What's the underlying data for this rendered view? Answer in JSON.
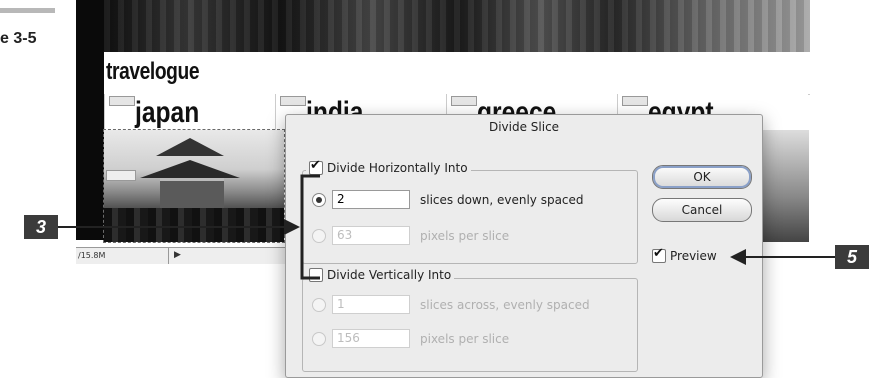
{
  "figure_label": "e 3-5",
  "document": {
    "title_text": "travelogue",
    "nav_cells": [
      "japan",
      "india",
      "greece",
      "egypt"
    ],
    "status_zoom": "/15.8M",
    "status_arrow": "▶"
  },
  "dialog": {
    "title": "Divide Slice",
    "horizontal": {
      "label": "Divide Horizontally Into",
      "checked": true,
      "rows": [
        {
          "value": "2",
          "label": "slices down, evenly spaced",
          "selected": true,
          "disabled": false
        },
        {
          "value": "63",
          "label": "pixels per slice",
          "selected": false,
          "disabled": true
        }
      ]
    },
    "vertical": {
      "label": "Divide Vertically Into",
      "checked": false,
      "rows": [
        {
          "value": "1",
          "label": "slices across, evenly spaced",
          "selected": false,
          "disabled": true
        },
        {
          "value": "156",
          "label": "pixels per slice",
          "selected": false,
          "disabled": true
        }
      ]
    },
    "ok_label": "OK",
    "cancel_label": "Cancel",
    "preview_label": "Preview",
    "preview_checked": true
  },
  "callouts": {
    "left": "3",
    "right": "5"
  },
  "colors": {
    "callout_bg": "#3b3b3b",
    "dialog_bg": "#ececec",
    "ok_focus": "#8aa0c8"
  }
}
